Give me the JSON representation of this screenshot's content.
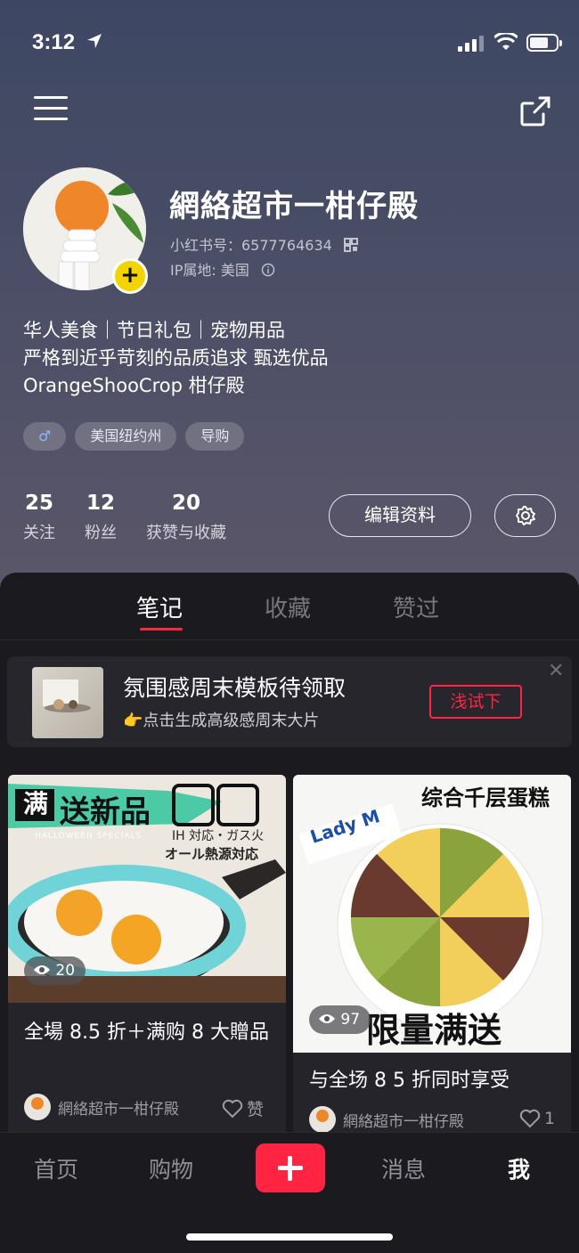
{
  "status_bar": {
    "time": "3:12"
  },
  "profile": {
    "name": "網絡超市一柑仔殿",
    "id_label": "小红书号：6577764634",
    "ip_label": "IP属地: 美国",
    "bio_lines": [
      "华人美食｜节日礼包｜宠物用品",
      "严格到近乎苛刻的品质追求 甄选优品",
      "OrangeShooCrop 柑仔殿"
    ],
    "tags": [
      {
        "label": "♂"
      },
      {
        "label": "美国纽约州"
      },
      {
        "label": "导购"
      }
    ]
  },
  "stats": [
    {
      "value": "25",
      "label": "关注"
    },
    {
      "value": "12",
      "label": "粉丝"
    },
    {
      "value": "20",
      "label": "获赞与收藏"
    }
  ],
  "actions": {
    "edit_label": "编辑资料"
  },
  "tabs": [
    {
      "label": "笔记",
      "active": true
    },
    {
      "label": "收藏"
    },
    {
      "label": "赞过"
    }
  ],
  "promo": {
    "title": "氛围感周末模板待领取",
    "subtitle": "👉点击生成高级感周末大片",
    "button": "浅试下"
  },
  "posts": [
    {
      "image_text": "送新品",
      "image_badge": "满",
      "image_sub": "HALLOWEEN SPECIALS",
      "image_jp1": "IH 対応・ガス火",
      "image_jp2": "オール熱源対応",
      "views": "20",
      "title": "全場 8.5 折＋满购 8 大贈品",
      "author": "網絡超市一柑仔殿",
      "like": "赞"
    },
    {
      "image_text": "综合千层蛋糕",
      "image_brand": "Lady M",
      "image_bottom": "限量满送",
      "views": "97",
      "title": "与全场 8 5 折同时享受",
      "author": "網絡超市一柑仔殿",
      "like": "1"
    }
  ],
  "nav": [
    {
      "label": "首页"
    },
    {
      "label": "购物"
    },
    {
      "label": "消息"
    },
    {
      "label": "我",
      "active": true
    }
  ],
  "colors": {
    "accent": "#ff2442",
    "badge": "#f4d400"
  }
}
